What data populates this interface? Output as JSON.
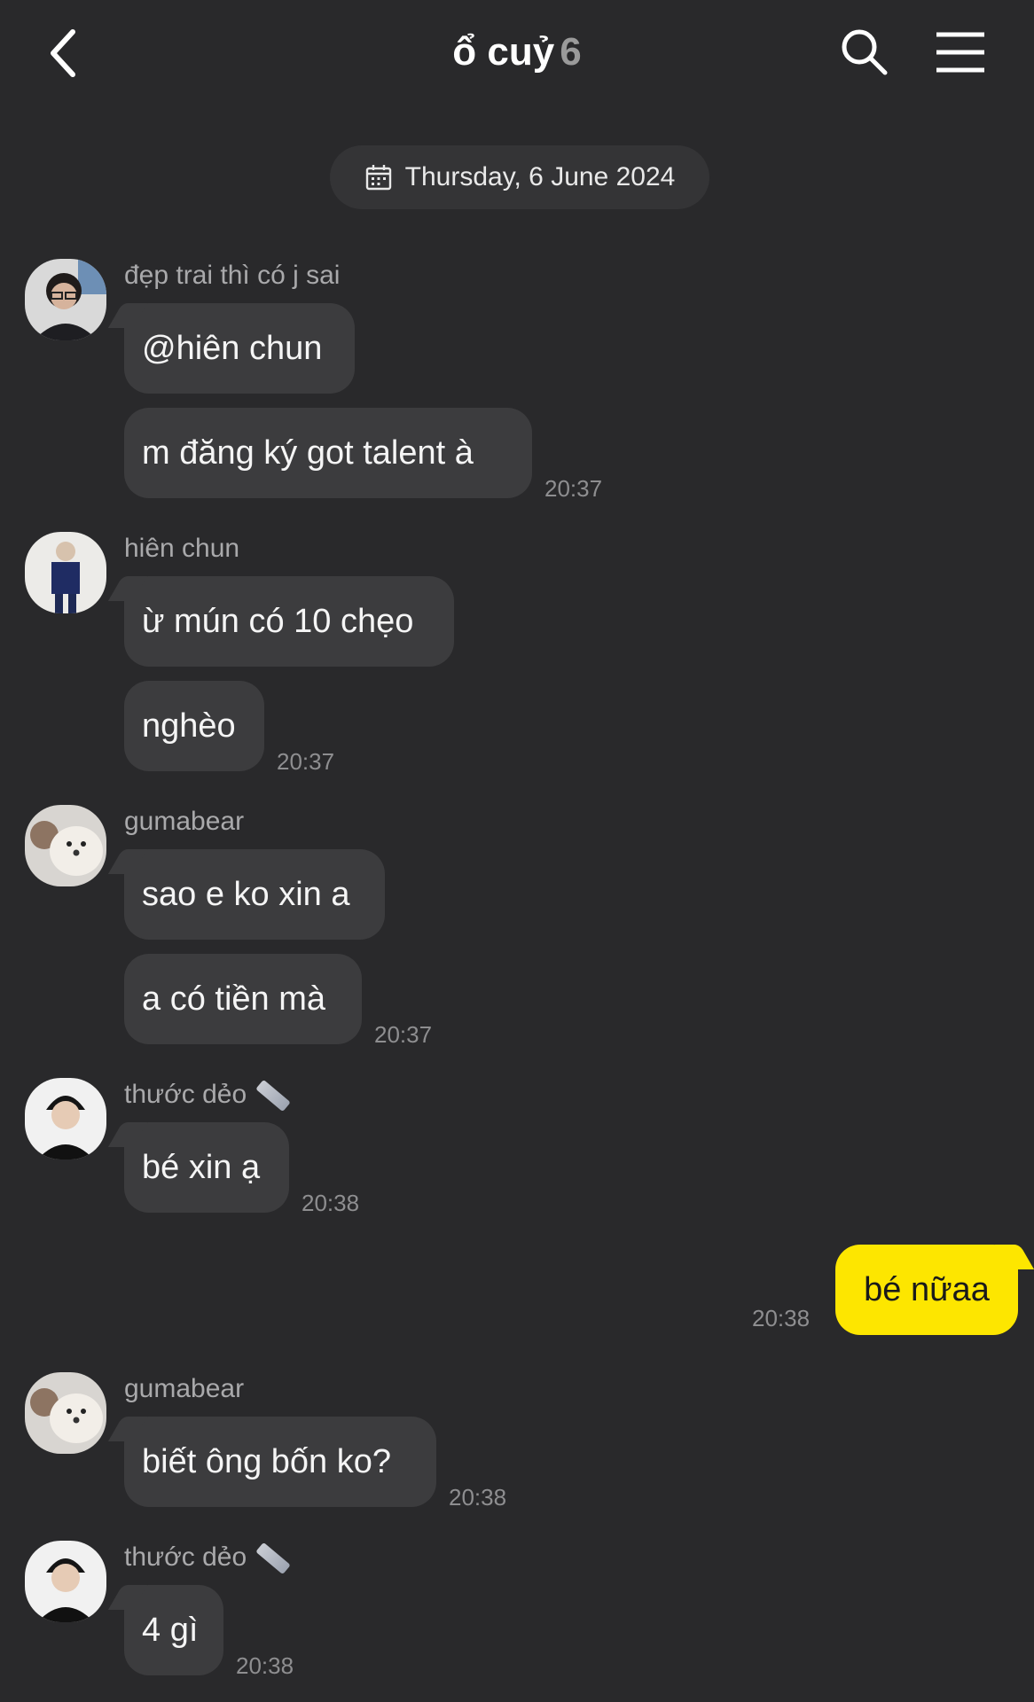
{
  "header": {
    "title": "ổ cuỷ",
    "member_count": "6",
    "back_icon": "chevron-left-icon",
    "search_icon": "search-icon",
    "menu_icon": "hamburger-menu-icon"
  },
  "date_divider": {
    "label": "Thursday, 6 June 2024",
    "icon": "calendar-icon"
  },
  "messages": [
    {
      "sender": "đẹp trai thì có j sai",
      "text": "@hiên chun"
    },
    {
      "text": "m đăng ký got talent à",
      "time": "20:37"
    },
    {
      "sender": "hiên chun",
      "text": "ừ mún có 10 chẹo"
    },
    {
      "text": "nghèo",
      "time": "20:37"
    },
    {
      "sender": "gumabear",
      "text": "sao e ko xin a"
    },
    {
      "text": "a có tiền mà",
      "time": "20:37"
    },
    {
      "sender": "thước dẻo",
      "text": "bé xin ạ",
      "time": "20:38"
    },
    {
      "text": "bé nữaa",
      "time": "20:38",
      "mine": true
    },
    {
      "sender": "gumabear",
      "text": "biết ông bốn ko?",
      "time": "20:38"
    },
    {
      "sender": "thước dẻo",
      "text": "4 gì",
      "time": "20:38"
    }
  ],
  "colors": {
    "background": "#29292b",
    "bubble_other": "#3c3c3e",
    "bubble_mine": "#fde600",
    "timestamp": "#8e8e90"
  }
}
